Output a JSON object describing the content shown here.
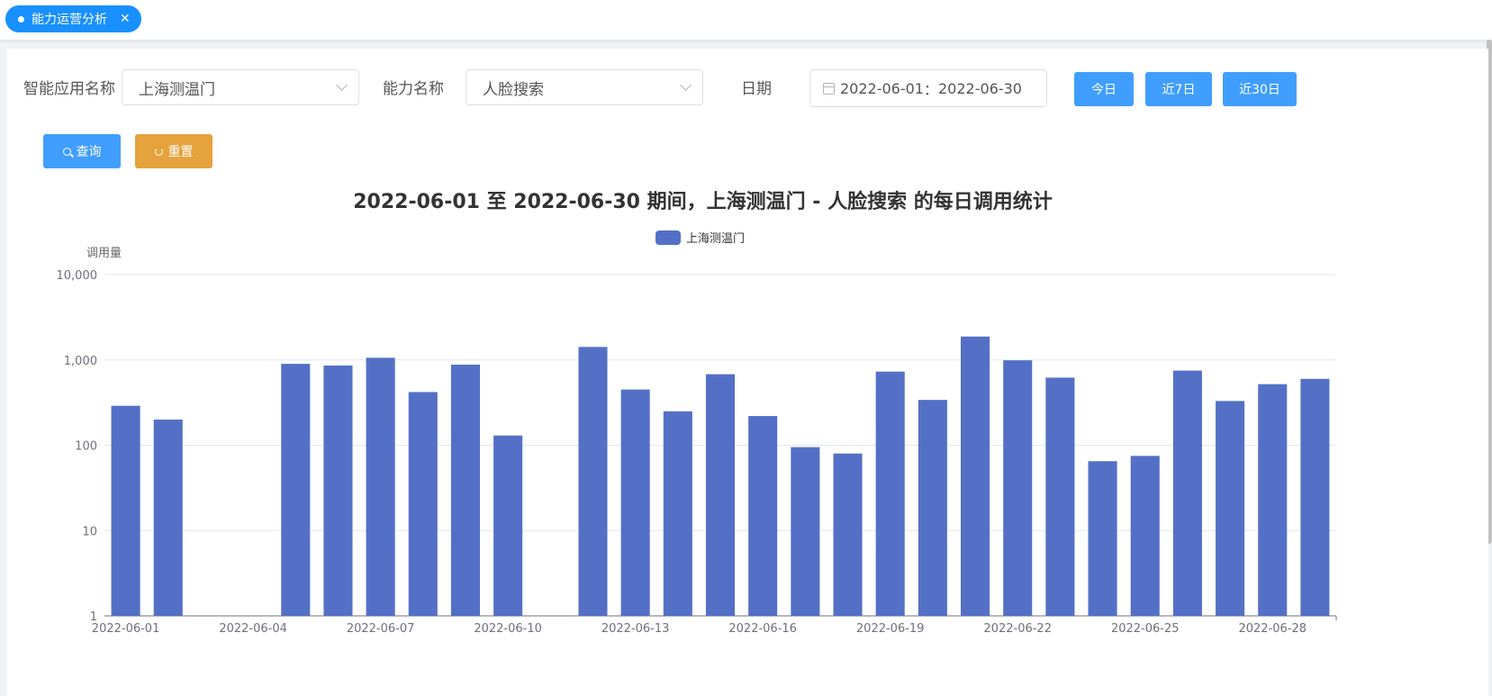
{
  "tab": {
    "label": "能力运营分析",
    "close": "✕"
  },
  "filters": {
    "app_label": "智能应用名称",
    "app_value": "上海测温门",
    "ability_label": "能力名称",
    "ability_value": "人脸搜索",
    "date_label": "日期",
    "date_start": "2022-06-01",
    "date_sep": "：",
    "date_end": "2022-06-30"
  },
  "buttons": {
    "today": "今日",
    "last7": "近7日",
    "last30": "近30日",
    "search": "查询",
    "reset": "重置"
  },
  "colors": {
    "primary": "#409eff",
    "warning": "#e6a23c",
    "bar": "#5470c6",
    "tab": "#1890ff"
  },
  "chart_data": {
    "type": "bar",
    "title": "2022-06-01 至 2022-06-30 期间，上海测温门 - 人脸搜索 的每日调用统计",
    "ylabel": "调用量",
    "yscale": "log",
    "ylim": [
      1,
      10000
    ],
    "yticks": [
      "1",
      "10",
      "100",
      "1,000",
      "10,000"
    ],
    "legend": {
      "position": "top-center",
      "entries": [
        "上海测温门"
      ]
    },
    "series": [
      {
        "name": "上海测温门",
        "values": [
          290,
          200,
          0,
          0,
          900,
          860,
          1060,
          420,
          880,
          130,
          0,
          1420,
          450,
          250,
          680,
          220,
          95,
          80,
          730,
          340,
          1880,
          990,
          620,
          65,
          75,
          750,
          330,
          520,
          600
        ]
      }
    ],
    "categories": [
      "2022-06-01",
      "2022-06-02",
      "2022-06-03",
      "2022-06-04",
      "2022-06-05",
      "2022-06-06",
      "2022-06-07",
      "2022-06-08",
      "2022-06-09",
      "2022-06-10",
      "2022-06-11",
      "2022-06-13",
      "2022-06-14",
      "2022-06-15",
      "2022-06-16",
      "2022-06-17",
      "2022-06-18",
      "2022-06-19",
      "2022-06-20",
      "2022-06-21",
      "2022-06-22",
      "2022-06-23",
      "2022-06-24",
      "2022-06-25",
      "2022-06-26",
      "2022-06-27",
      "2022-06-28",
      "2022-06-29",
      "2022-06-30"
    ],
    "xtick_labels": [
      "2022-06-01",
      "2022-06-04",
      "2022-06-07",
      "2022-06-10",
      "2022-06-13",
      "2022-06-16",
      "2022-06-19",
      "2022-06-22",
      "2022-06-25",
      "2022-06-28"
    ]
  }
}
